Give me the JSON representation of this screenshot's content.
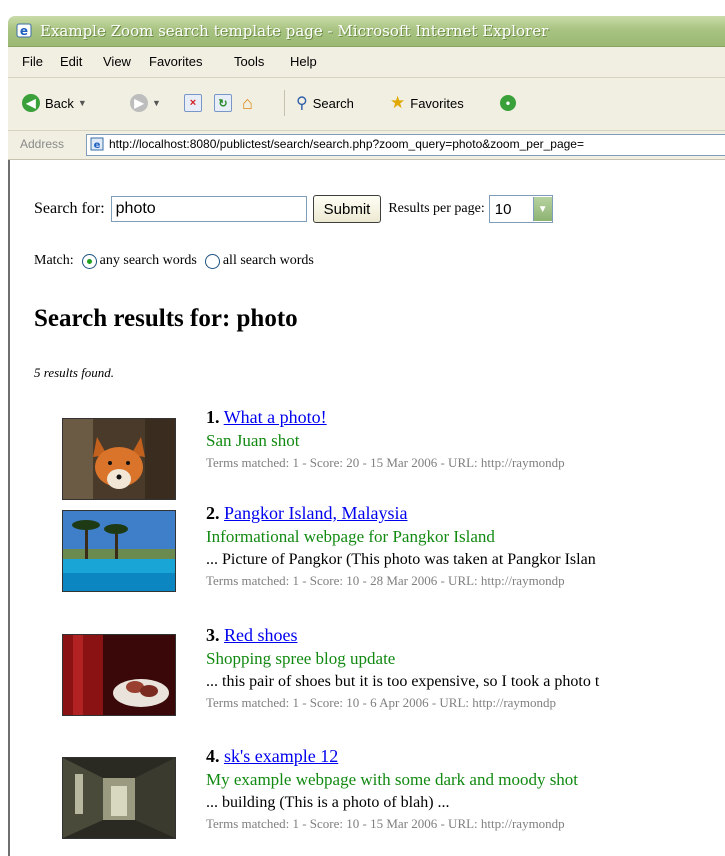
{
  "window": {
    "title": "Example Zoom search template page - Microsoft Internet Explorer"
  },
  "menu": [
    "File",
    "Edit",
    "View",
    "Favorites",
    "Tools",
    "Help"
  ],
  "toolbar": {
    "back_label": "Back",
    "search_label": "Search",
    "favorites_label": "Favorites"
  },
  "address": {
    "label": "Address",
    "url": "http://localhost:8080/publictest/search/search.php?zoom_query=photo&zoom_per_page="
  },
  "form": {
    "search_label": "Search for:",
    "query": "photo",
    "submit_label": "Submit",
    "rpp_label": "Results per page:",
    "rpp_value": "10",
    "match_label": "Match:",
    "match_any": "any search words",
    "match_all": "all search words",
    "match_selected": "any"
  },
  "results_heading": "Search results for: photo",
  "results_found": "5 results found.",
  "results": [
    {
      "num": "1.",
      "title": "What a photo!",
      "desc": "San Juan shot",
      "snippet": "",
      "info": "Terms matched: 1  -  Score: 20  -  15 Mar 2006  -  URL: http://raymondp"
    },
    {
      "num": "2.",
      "title": "Pangkor Island, Malaysia",
      "desc": "Informational webpage for Pangkor Island",
      "snippet": "... Picture of Pangkor (This photo was taken at Pangkor Islan",
      "info": "Terms matched: 1  -  Score: 10  -  28 Mar 2006  -  URL: http://raymondp"
    },
    {
      "num": "3.",
      "title": "Red shoes",
      "desc": "Shopping spree blog update",
      "snippet": "... this pair of shoes but it is too expensive, so I took a photo t",
      "info": "Terms matched: 1  -  Score: 10  -  6 Apr 2006  -  URL: http://raymondp"
    },
    {
      "num": "4.",
      "title": "sk's example 12",
      "desc": "My example webpage with some dark and moody shot",
      "snippet": "... building (This is a photo of blah) ...",
      "info": "Terms matched: 1  -  Score: 10  -  15 Mar 2006  -  URL: http://raymondp"
    }
  ]
}
